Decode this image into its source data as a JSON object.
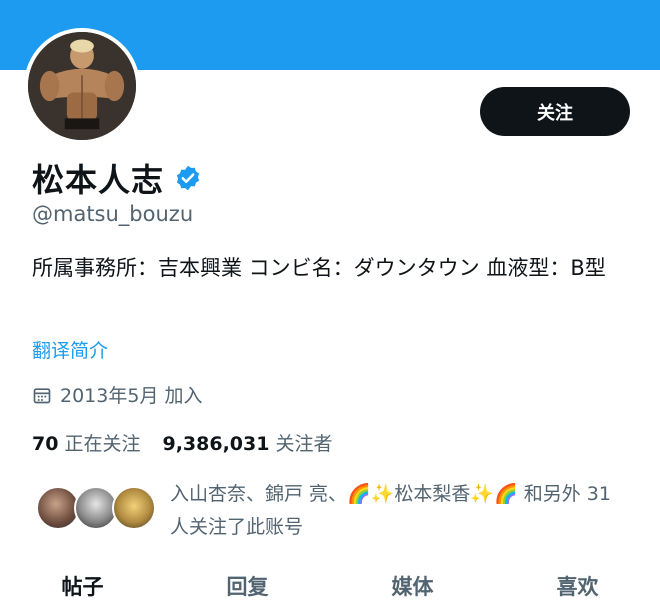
{
  "profile": {
    "display_name": "松本人志",
    "handle": "@matsu_bouzu",
    "bio": "所属事務所：吉本興業 コンビ名：ダウンタウン 血液型：B型",
    "translate_label": "翻译简介",
    "joined": "2013年5月 加入",
    "follow_label": "关注",
    "verified_icon": "verified-badge-icon",
    "accent_color": "#1d9bf0"
  },
  "stats": {
    "following_count": "70",
    "following_label": "正在关注",
    "followers_count": "9,386,031",
    "followers_label": "关注者"
  },
  "known_followers": {
    "text": "入山杏奈、錦戸 亮、🌈✨松本梨香✨🌈 和另外 31 人关注了此账号"
  },
  "tabs": [
    {
      "label": "帖子",
      "active": true
    },
    {
      "label": "回复",
      "active": false
    },
    {
      "label": "媒体",
      "active": false
    },
    {
      "label": "喜欢",
      "active": false
    }
  ]
}
